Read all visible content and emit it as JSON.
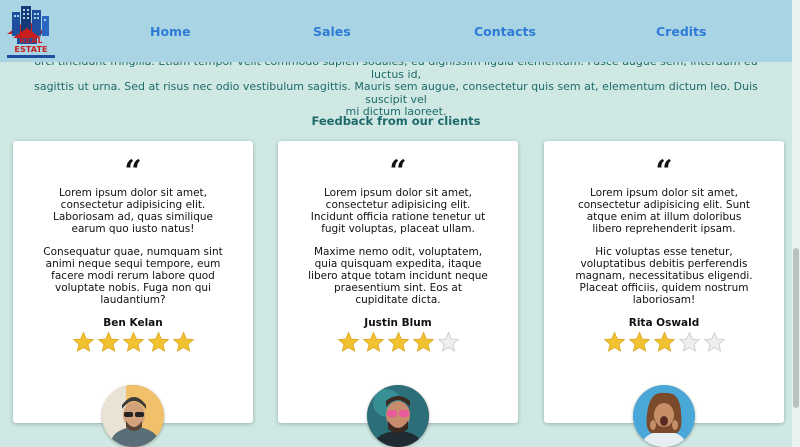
{
  "header": {
    "logo_text": "REAL ESTATE",
    "nav": [
      {
        "label": "Home"
      },
      {
        "label": "Sales"
      },
      {
        "label": "Contacts"
      },
      {
        "label": "Credits"
      }
    ]
  },
  "intro": {
    "lines": [
      "orci tincidunt fringilla. Etiam tempor velit commodo sapien sodales, eu dignissim ligula elementum. Fusce augue sem, interdum eu luctus id,",
      "sagittis ut urna. Sed at risus nec odio vestibulum sagittis. Mauris sem augue, consectetur quis sem at, elementum dictum leo. Duis suscipit vel",
      "mi dictum laoreet."
    ]
  },
  "feedback": {
    "heading": "Feedback from our clients",
    "cards": [
      {
        "p1": "Lorem ipsum dolor sit amet, consectetur adipisicing elit. Laboriosam ad, quas similique earum quo iusto natus!",
        "p2": "Consequatur quae, numquam sint animi neque sequi tempore, eum facere modi rerum labore quod voluptate nobis. Fuga non qui laudantium?",
        "name": "Ben Kelan",
        "rating": 5
      },
      {
        "p1": "Lorem ipsum dolor sit amet, consectetur adipisicing elit. Incidunt officia ratione tenetur ut fugit voluptas, placeat ullam.",
        "p2": "Maxime nemo odit, voluptatem, quia quisquam expedita, itaque libero atque totam incidunt neque praesentium sint. Eos at cupiditate dicta.",
        "name": "Justin Blum",
        "rating": 4
      },
      {
        "p1": "Lorem ipsum dolor sit amet, consectetur adipisicing elit. Sunt atque enim at illum doloribus libero reprehenderit ipsam.",
        "p2": "Hic voluptas esse tenetur, voluptatibus debitis perferendis magnam, necessitatibus eligendi. Placeat officiis, quidem nostrum laboriosam!",
        "name": "Rita Oswald",
        "rating": 3
      }
    ]
  },
  "colors": {
    "page_bg": "#cfe8e3",
    "header_bg": "#a8d4e4",
    "nav_text": "#2e7bd6",
    "body_text": "#1e6a6a",
    "star_filled": "#f3c233",
    "star_empty": "#eeeeee"
  }
}
